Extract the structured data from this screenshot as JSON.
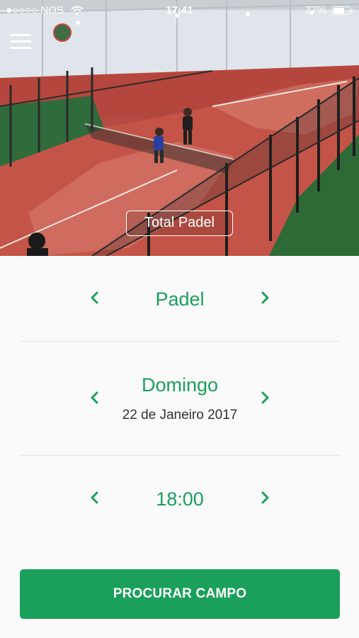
{
  "status_bar": {
    "carrier": "●○○○○ NOS",
    "time": "17:41",
    "battery_percent": "77%",
    "battery_level": 0.77,
    "wifi_icon": "wifi-icon"
  },
  "header": {
    "menu_icon": "hamburger-menu-icon",
    "club_name": "Total Padel"
  },
  "selectors": {
    "sport": {
      "label": "Padel",
      "prev_icon": "chevron-left-icon",
      "next_icon": "chevron-right-icon"
    },
    "day": {
      "label": "Domingo",
      "date": "22 de Janeiro 2017",
      "prev_icon": "chevron-left-icon",
      "next_icon": "chevron-right-icon"
    },
    "time": {
      "label": "18:00",
      "prev_icon": "chevron-left-icon",
      "next_icon": "chevron-right-icon"
    }
  },
  "actions": {
    "search_label": "PROCURAR CAMPO"
  },
  "colors": {
    "accent": "#1aa05a",
    "background": "#fafafa",
    "divider": "#e4e4e4",
    "date_text": "#333333"
  }
}
